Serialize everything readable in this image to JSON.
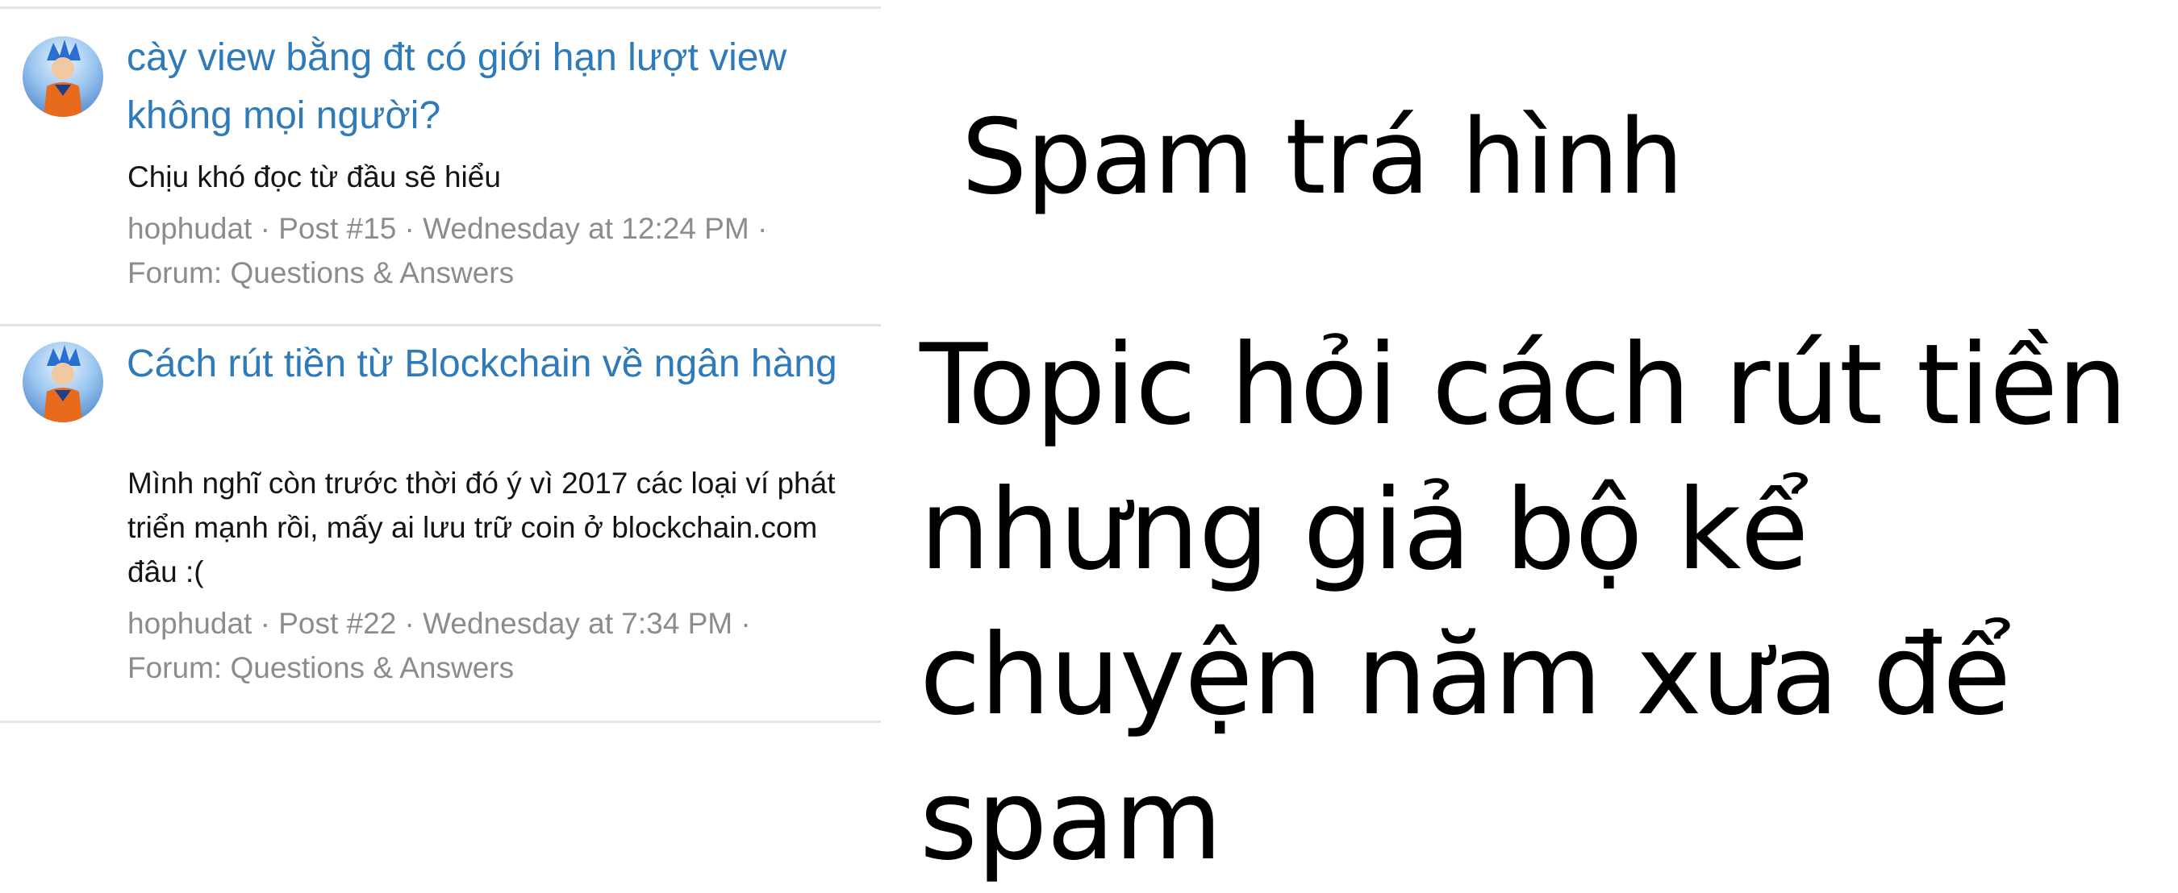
{
  "posts": [
    {
      "title": "cày view bằng đt có giới hạn lượt view không mọi người?",
      "snippet": "Chịu khó đọc từ đầu sẽ hiểu",
      "author": "hophudat",
      "post_number": "Post #15",
      "timestamp": "Wednesday at 12:24 PM",
      "forum": "Forum: Questions & Answers"
    },
    {
      "title": "Cách rút tiền từ Blockchain về ngân hàng",
      "snippet": "Mình nghĩ còn trước thời đó ý vì 2017 các loại ví phát triển mạnh rồi, mấy ai lưu trữ coin ở blockchain.com đâu :(",
      "author": "hophudat",
      "post_number": "Post #22",
      "timestamp": "Wednesday at 7:34 PM",
      "forum": "Forum: Questions & Answers"
    }
  ],
  "meta_separator": " · ",
  "captions": {
    "spam_label": "Spam trá hình",
    "explanation": "Topic hỏi cách rút tiền nhưng giả bộ kể chuyện năm xưa để spam"
  },
  "colors": {
    "title_link": "#2f7ab8",
    "meta_text": "#8c8c8c",
    "divider": "#e4e4e4"
  }
}
